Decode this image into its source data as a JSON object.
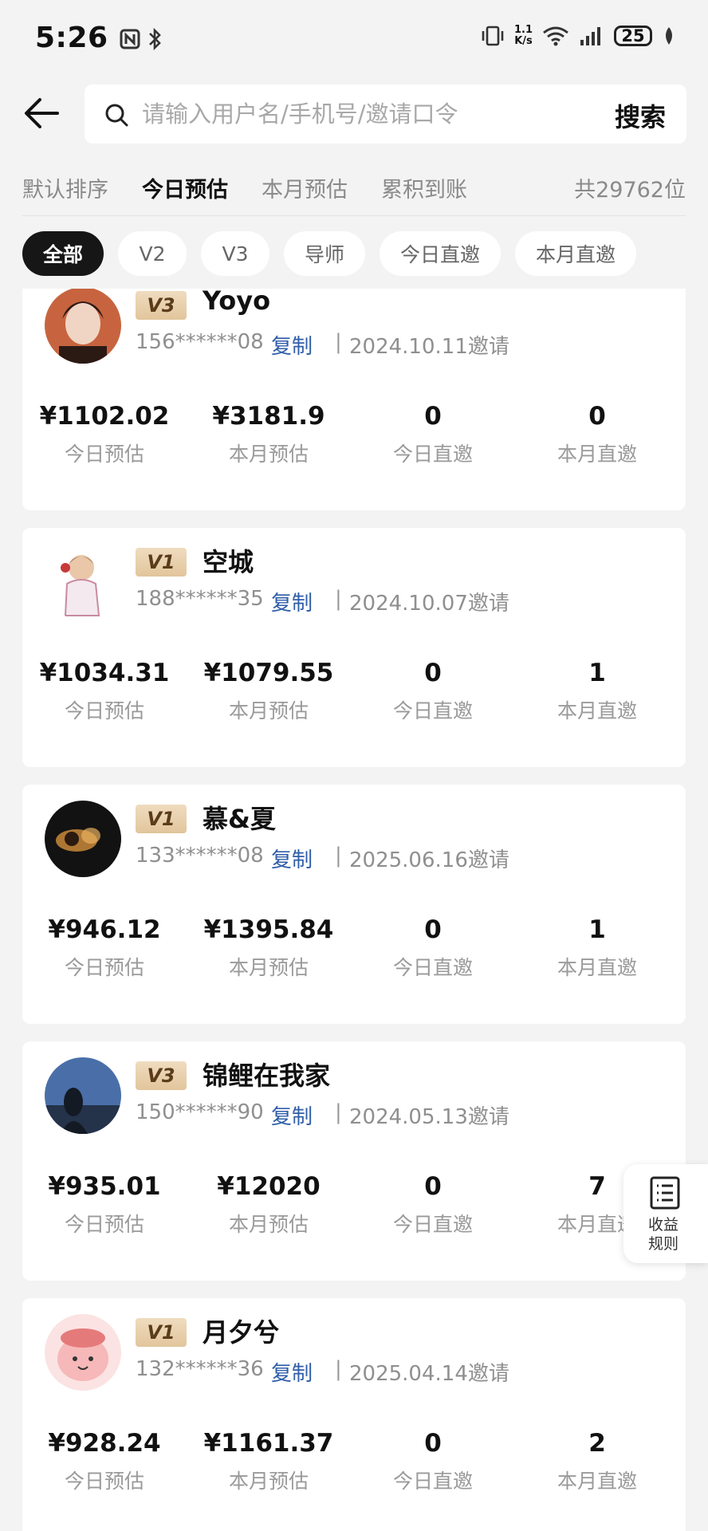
{
  "status_bar": {
    "time": "5:26",
    "net_speed_top": "1.1",
    "net_speed_bottom": "K/s",
    "battery": "25"
  },
  "search": {
    "placeholder": "请输入用户名/手机号/邀请口令",
    "button_label": "搜索"
  },
  "sort_tabs": [
    {
      "label": "默认排序",
      "active": false
    },
    {
      "label": "今日预估",
      "active": true
    },
    {
      "label": "本月预估",
      "active": false
    },
    {
      "label": "累积到账",
      "active": false
    }
  ],
  "total_count": "共29762位",
  "filters": [
    {
      "label": "全部",
      "active": true
    },
    {
      "label": "V2",
      "active": false
    },
    {
      "label": "V3",
      "active": false
    },
    {
      "label": "导师",
      "active": false
    },
    {
      "label": "今日直邀",
      "active": false
    },
    {
      "label": "本月直邀",
      "active": false
    }
  ],
  "stat_labels": [
    "今日预估",
    "本月预估",
    "今日直邀",
    "本月直邀"
  ],
  "copy_label": "复制",
  "separator": "|",
  "users": [
    {
      "level": "V3",
      "name": "Yoyo",
      "phone": "156******08",
      "invite_date": "2024.10.11邀请",
      "today_est": "¥1102.02",
      "month_est": "¥3181.9",
      "today_invites": "0",
      "month_invites": "0"
    },
    {
      "level": "V1",
      "name": "空城",
      "phone": "188******35",
      "invite_date": "2024.10.07邀请",
      "today_est": "¥1034.31",
      "month_est": "¥1079.55",
      "today_invites": "0",
      "month_invites": "1"
    },
    {
      "level": "V1",
      "name": "慕&夏",
      "phone": "133******08",
      "invite_date": "2025.06.16邀请",
      "today_est": "¥946.12",
      "month_est": "¥1395.84",
      "today_invites": "0",
      "month_invites": "1"
    },
    {
      "level": "V3",
      "name": "锦鲤在我家",
      "phone": "150******90",
      "invite_date": "2024.05.13邀请",
      "today_est": "¥935.01",
      "month_est": "¥12020",
      "today_invites": "0",
      "month_invites": "7"
    },
    {
      "level": "V1",
      "name": "月夕兮",
      "phone": "132******36",
      "invite_date": "2025.04.14邀请",
      "today_est": "¥928.24",
      "month_est": "¥1161.37",
      "today_invites": "0",
      "month_invites": "2"
    }
  ],
  "rules_button": {
    "line1": "收益",
    "line2": "规则"
  }
}
